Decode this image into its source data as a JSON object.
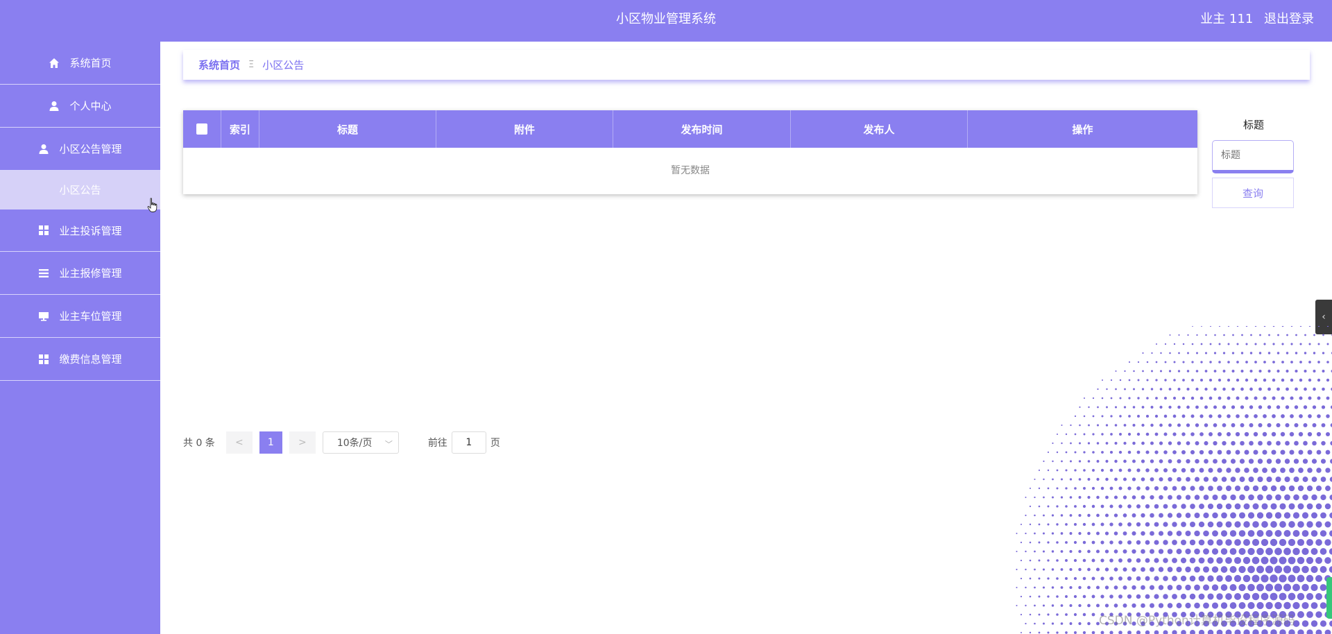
{
  "header": {
    "title": "小区物业管理系统",
    "user_label": "业主 111",
    "logout_label": "退出登录"
  },
  "sidebar": {
    "items": [
      {
        "label": "系统首页",
        "icon": "home-icon"
      },
      {
        "label": "个人中心",
        "icon": "user-icon"
      },
      {
        "label": "小区公告管理",
        "icon": "user-icon"
      },
      {
        "label": "小区公告",
        "icon": ""
      },
      {
        "label": "业主投诉管理",
        "icon": "grid-icon"
      },
      {
        "label": "业主报修管理",
        "icon": "list-icon"
      },
      {
        "label": "业主车位管理",
        "icon": "monitor-icon"
      },
      {
        "label": "缴费信息管理",
        "icon": "grid-icon"
      }
    ]
  },
  "breadcrumb": {
    "home": "系统首页",
    "separator": "Ξ",
    "current": "小区公告"
  },
  "table": {
    "columns": [
      "索引",
      "标题",
      "附件",
      "发布时间",
      "发布人",
      "操作"
    ],
    "empty_text": "暂无数据"
  },
  "search": {
    "label": "标题",
    "placeholder": "标题",
    "button": "查询"
  },
  "pagination": {
    "total": "共 0 条",
    "prev": "<",
    "page": "1",
    "next": ">",
    "page_size": "10条/页",
    "goto_label": "前往",
    "goto_value": "1",
    "goto_unit": "页"
  },
  "watermark": "CSDN @Python计算机毕设程序源码",
  "colors": {
    "accent": "#8a7ff0",
    "submenu_active": "#d6d1f8",
    "dots": "#7a6ad8"
  }
}
